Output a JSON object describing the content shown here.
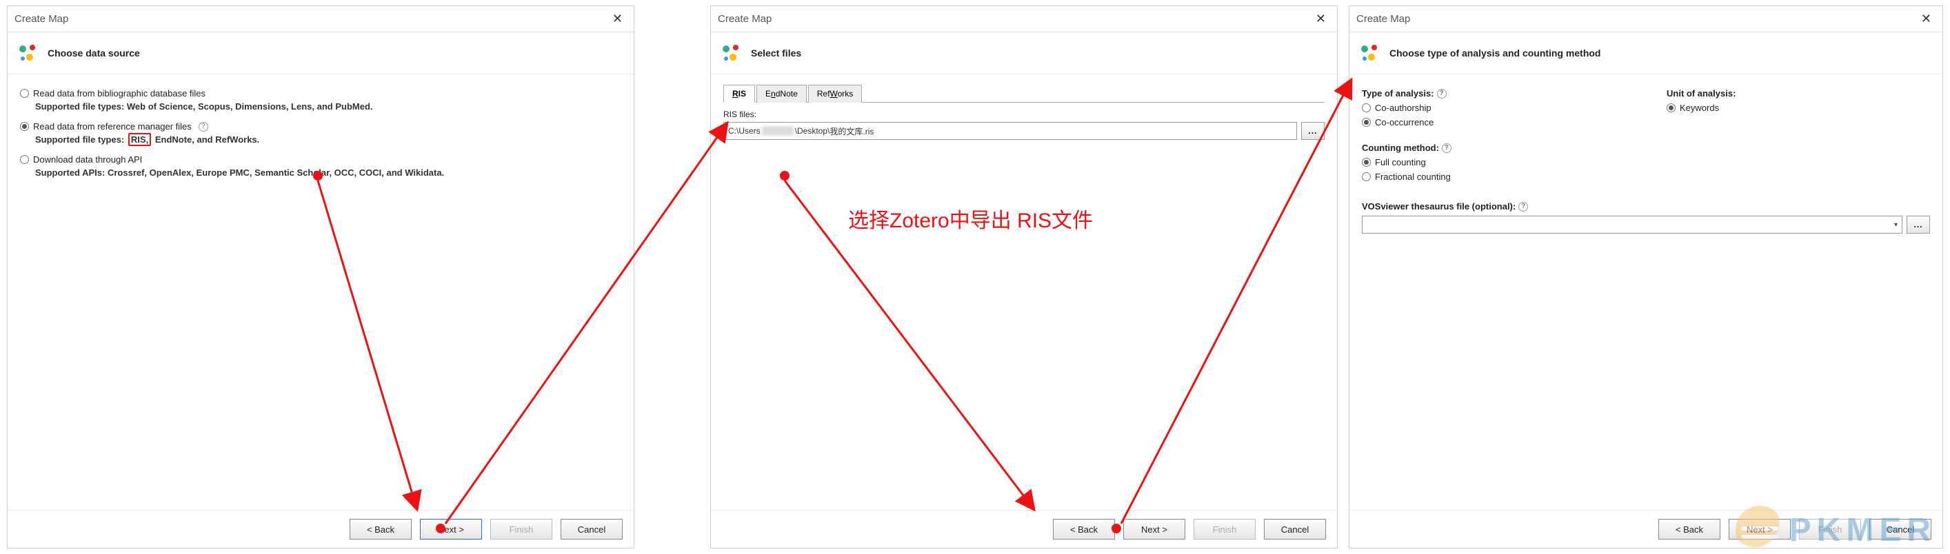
{
  "dialog1": {
    "title": "Create Map",
    "banner": "Choose data source",
    "opt1": "Read data from bibliographic database files",
    "opt1_sub": "Supported file types: Web of Science, Scopus, Dimensions, Lens, and PubMed.",
    "opt2": "Read data from reference manager files",
    "opt2_sub_pre": "Supported file types: ",
    "opt2_sub_ris": "RIS,",
    "opt2_sub_post": "EndNote, and RefWorks.",
    "opt3": "Download data through API",
    "opt3_sub": "Supported APIs: Crossref, OpenAlex, Europe PMC, Semantic Scholar, OCC, COCI, and Wikidata."
  },
  "dialog2": {
    "title": "Create Map",
    "banner": "Select files",
    "tab_ris_pre": "R",
    "tab_ris_mid": "I",
    "tab_ris_post": "S",
    "tab_endnote_pre": "E",
    "tab_endnote_mid": "n",
    "tab_endnote_post": "dNote",
    "tab_refworks_pre": "Ref",
    "tab_refworks_mid": "W",
    "tab_refworks_post": "orks",
    "files_label": "RIS files:",
    "file_value_pre": "C:\\Users",
    "file_value_mid": "\\Desktop\\",
    "file_value_post": "我的文库.ris",
    "browse": "..."
  },
  "dialog3": {
    "title": "Create Map",
    "banner": "Choose type of analysis and counting method",
    "type_label": "Type of analysis:",
    "type_opt1": "Co-authorship",
    "type_opt2": "Co-occurrence",
    "unit_label": "Unit of analysis:",
    "unit_opt1": "Keywords",
    "count_label": "Counting method:",
    "count_opt1": "Full counting",
    "count_opt2": "Fractional counting",
    "thesaurus_label": "VOSviewer thesaurus file (optional):",
    "browse": "..."
  },
  "buttons": {
    "back": "< Back",
    "next": "Next >",
    "finish": "Finish",
    "cancel": "Cancel"
  },
  "annotation": "选择Zotero中导出 RIS文件",
  "watermark": "PKMER"
}
